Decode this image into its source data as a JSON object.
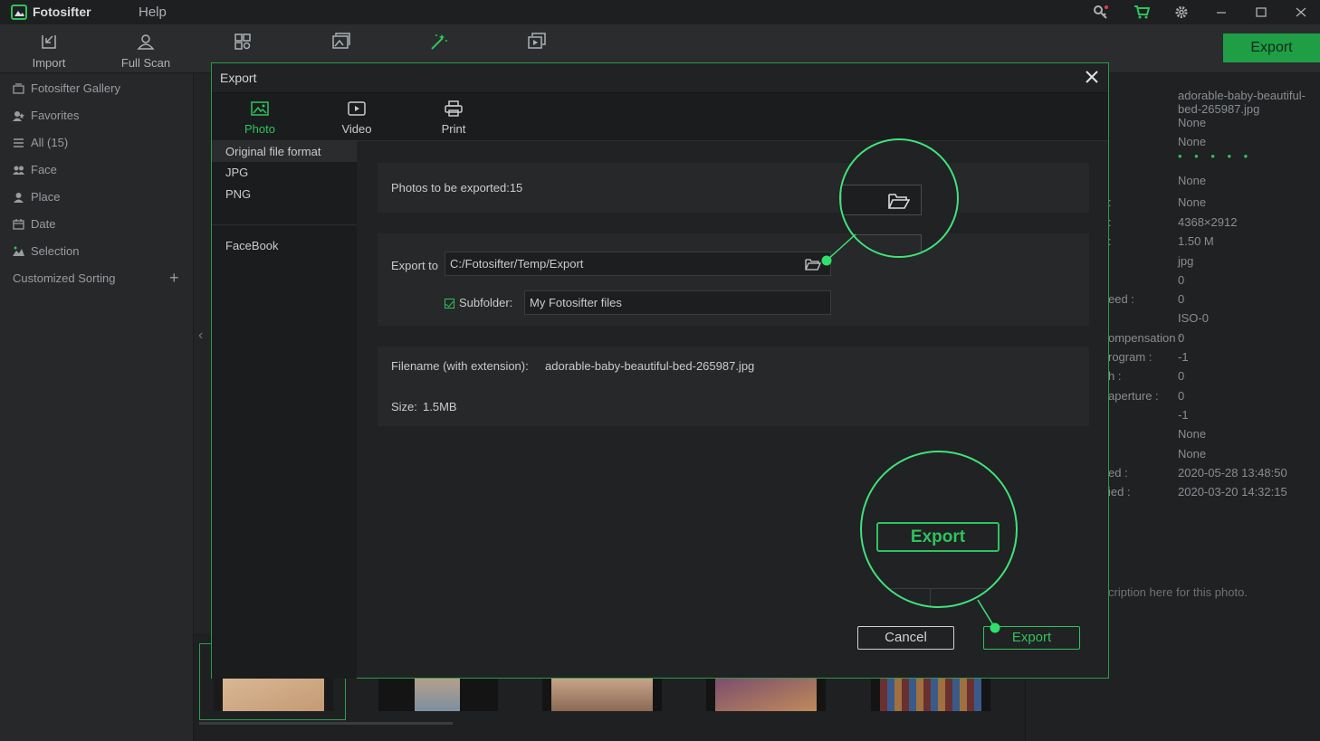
{
  "app": {
    "name": "Fotosifter",
    "menu_help": "Help"
  },
  "toolbar": {
    "tools": [
      {
        "label": "Import",
        "icon": "import-icon"
      },
      {
        "label": "Full Scan",
        "icon": "full-scan-icon"
      },
      {
        "label": "",
        "icon": "auto-sort-icon"
      },
      {
        "label": "",
        "icon": "view-icon"
      },
      {
        "label": "",
        "icon": "edit-icon"
      },
      {
        "label": "",
        "icon": "slideshow-icon"
      }
    ],
    "export_label": "Export"
  },
  "sidebar": {
    "items": [
      {
        "label": "Fotosifter Gallery",
        "icon": "gallery-icon"
      },
      {
        "label": "Favorites",
        "icon": "favorites-icon"
      },
      {
        "label": "All (15)",
        "icon": "list-icon"
      },
      {
        "label": "Face",
        "icon": "face-icon"
      },
      {
        "label": "Place",
        "icon": "place-icon"
      },
      {
        "label": "Date",
        "icon": "calendar-icon"
      },
      {
        "label": "Selection",
        "icon": "selection-icon"
      }
    ],
    "custom_sorting": "Customized Sorting"
  },
  "info_panel": {
    "filename": "adorable-baby-beautiful-bed-265987.jpg",
    "rows": [
      {
        "label": "",
        "value": "None"
      },
      {
        "label": "",
        "value": "None"
      },
      {
        "label": "",
        "value": "None"
      },
      {
        "label": ":",
        "value": "None"
      },
      {
        "label": ":",
        "value": "4368×2912"
      },
      {
        "label": ":",
        "value": "1.50  M"
      },
      {
        "label": "",
        "value": "jpg"
      },
      {
        "label": "",
        "value": "0"
      },
      {
        "label": "eed :",
        "value": "0"
      },
      {
        "label": "",
        "value": "ISO-0"
      },
      {
        "label": "ompensation :",
        "value": "0"
      },
      {
        "label": "rogram :",
        "value": "-1"
      },
      {
        "label": "h :",
        "value": "0"
      },
      {
        "label": "aperture :",
        "value": "0"
      },
      {
        "label": "",
        "value": "-1"
      },
      {
        "label": "",
        "value": "None"
      },
      {
        "label": "",
        "value": "None"
      },
      {
        "label": "ed :",
        "value": "2020-05-28 13:48:50"
      },
      {
        "label": "ied :",
        "value": "2020-03-20 14:32:15"
      }
    ],
    "description_placeholder": "cription here for this photo."
  },
  "dialog": {
    "title": "Export",
    "tabs": [
      {
        "label": "Photo",
        "icon": "photo-icon"
      },
      {
        "label": "Video",
        "icon": "video-icon"
      },
      {
        "label": "Print",
        "icon": "printer-icon"
      }
    ],
    "formats": [
      "Original file format",
      "JPG",
      "PNG"
    ],
    "share": [
      "FaceBook"
    ],
    "photos_to_export": "Photos to be exported:15",
    "export_to_label": "Export to",
    "export_path": "C:/Fotosifter/Temp/Export",
    "subfolder_label": "Subfolder:",
    "subfolder_value": "My Fotosifter files",
    "filename_label": "Filename (with extension):",
    "filename_value": "adorable-baby-beautiful-bed-265987.jpg",
    "size_label": "Size:",
    "size_value": "1.5MB",
    "cancel_label": "Cancel",
    "export_label": "Export",
    "callout_export_label": "Export"
  }
}
